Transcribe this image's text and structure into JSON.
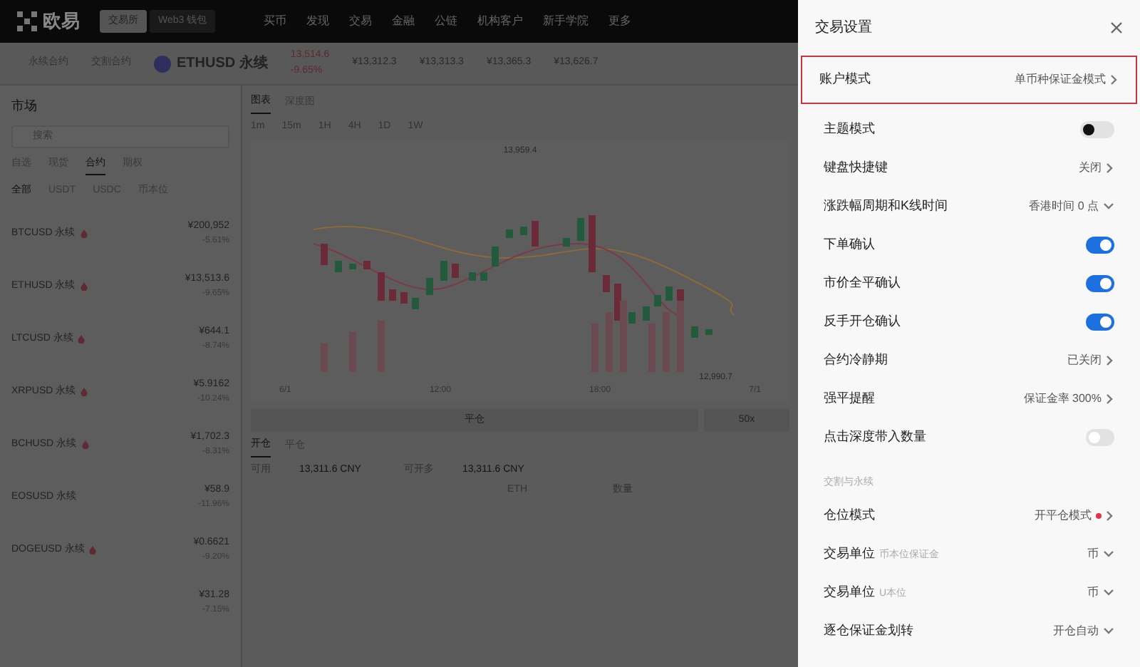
{
  "header": {
    "logo": "欧易",
    "switch": [
      {
        "label": "交易所",
        "selected": true
      },
      {
        "label": "Web3 钱包",
        "selected": false
      }
    ],
    "nav": [
      "买币",
      "发现",
      "交易",
      "金融",
      "公链",
      "机构客户",
      "新手学院",
      "更多"
    ]
  },
  "instrument_bar": {
    "tabs": [
      "永续合约",
      "交割合约"
    ],
    "symbol": "ETHUSD 永续",
    "price": "13,514.6",
    "change": "-9.65%",
    "stats": [
      "¥13,312.3",
      "¥13,313.3",
      "¥13,365.3",
      "¥13,626.7"
    ]
  },
  "market": {
    "title": "市场",
    "search": {
      "placeholder": "搜索"
    },
    "tabs": [
      {
        "label": "自选",
        "selected": false
      },
      {
        "label": "现货",
        "selected": false
      },
      {
        "label": "合约",
        "selected": true
      },
      {
        "label": "期权",
        "selected": false
      }
    ],
    "filters": [
      {
        "label": "全部",
        "selected": true
      },
      {
        "label": "USDT",
        "selected": false
      },
      {
        "label": "USDC",
        "selected": false
      },
      {
        "label": "币本位",
        "selected": false
      }
    ],
    "rows": [
      {
        "symbol": "BTCUSD 永续",
        "hot": true,
        "price": "¥200,952",
        "change": "-5.61%"
      },
      {
        "symbol": "ETHUSD 永续",
        "hot": true,
        "price": "¥13,513.6",
        "change": "-9.65%"
      },
      {
        "symbol": "LTCUSD 永续",
        "hot": true,
        "price": "¥644.1",
        "change": "-8.74%"
      },
      {
        "symbol": "XRPUSD 永续",
        "hot": true,
        "price": "¥5.9162",
        "change": "-10.24%"
      },
      {
        "symbol": "BCHUSD 永续",
        "hot": true,
        "price": "¥1,702.3",
        "change": "-8.31%"
      },
      {
        "symbol": "EOSUSD 永续",
        "hot": false,
        "price": "¥58.9",
        "change": "-11.96%"
      },
      {
        "symbol": "DOGEUSD 永续",
        "hot": true,
        "price": "¥0.6621",
        "change": "-9.20%"
      },
      {
        "symbol": "",
        "hot": false,
        "price": "¥31.28",
        "change": "-7.15%"
      }
    ]
  },
  "chart_panel": {
    "tabs": [
      {
        "label": "图表",
        "selected": true
      },
      {
        "label": "深度图",
        "selected": false
      }
    ],
    "intervals": [
      "1m",
      "15m",
      "1H",
      "4H",
      "1D",
      "1W"
    ],
    "price_high": "13,959.4",
    "price_low": "12,990.7",
    "x_labels": [
      "6/1",
      "12:00",
      "18:00",
      "7/1"
    ]
  },
  "order": {
    "side": "平仓",
    "leverage": "50x",
    "tabs": [
      {
        "label": "开仓",
        "selected": true
      },
      {
        "label": "平仓",
        "selected": false
      }
    ],
    "fields": [
      {
        "label": "可用",
        "value": "13,311.6 CNY"
      },
      {
        "label": "可开多",
        "value": "13,311.6 CNY"
      }
    ],
    "units": [
      "ETH",
      "数量"
    ]
  },
  "settings": {
    "title": "交易设置",
    "rows": [
      {
        "kind": "link",
        "label": "账户模式",
        "value": "单币种保证金模式",
        "highlighted": true
      },
      {
        "kind": "theme",
        "label": "主题模式",
        "on": false
      },
      {
        "kind": "link",
        "label": "键盘快捷键",
        "value": "关闭",
        "highlighted": false
      },
      {
        "kind": "select",
        "label": "涨跌幅周期和K线时间",
        "value": "香港时间 0 点"
      },
      {
        "kind": "toggle",
        "label": "下单确认",
        "on": true
      },
      {
        "kind": "toggle",
        "label": "市价全平确认",
        "on": true
      },
      {
        "kind": "toggle",
        "label": "反手开仓确认",
        "on": true
      },
      {
        "kind": "link",
        "label": "合约冷静期",
        "value": "已关闭",
        "highlighted": false
      },
      {
        "kind": "link",
        "label": "强平提醒",
        "value": "保证金率 300%",
        "highlighted": false
      },
      {
        "kind": "toggle",
        "label": "点击深度带入数量",
        "on": false
      }
    ],
    "section": "交割与永续",
    "section_rows": [
      {
        "kind": "link",
        "label": "仓位模式",
        "value": "开平仓模式",
        "dot": true
      },
      {
        "kind": "select",
        "label": "交易单位",
        "hint": "币本位保证金",
        "value": "币"
      },
      {
        "kind": "select",
        "label": "交易单位",
        "hint": "U本位",
        "value": "币"
      },
      {
        "kind": "select",
        "label": "逐仓保证金划转",
        "value": "开仓自动"
      }
    ]
  }
}
